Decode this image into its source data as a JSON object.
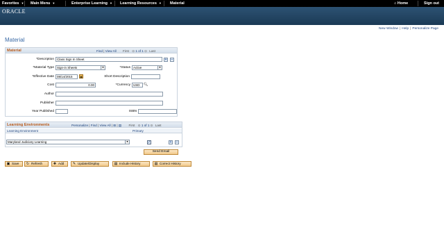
{
  "topnav": {
    "favorites": "Favorites",
    "main_menu": "Main Menu",
    "enterprise_learning": "Enterprise Learning",
    "learning_resources": "Learning Resources",
    "material": "Material",
    "home": "Home",
    "sign_out": "Sign out"
  },
  "brand": {
    "logo": "ORACLE"
  },
  "header_links": {
    "new_window": "New Window",
    "help": "Help",
    "personalize_page": "Personalize Page"
  },
  "page_title": "Material",
  "material_box": {
    "title": "Material",
    "find": "Find",
    "view_all": "View All",
    "first": "First",
    "counter": "1 of 1",
    "last": "Last",
    "description_label": "*Description",
    "description_value": "Class Sign In Sheet",
    "material_type_label": "*Material Type",
    "material_type_value": "Sign-in Sheets",
    "status_label": "*Status",
    "status_value": "Active",
    "effective_date_label": "*Effective Date",
    "effective_date_value": "08/14/2015",
    "short_description_label": "Short Description",
    "short_description_value": "",
    "cost_label": "Cost",
    "cost_value": "0.00",
    "currency_label": "*Currency",
    "currency_value": "USD",
    "author_label": "Author",
    "author_value": "",
    "publisher_label": "Publisher",
    "publisher_value": "",
    "year_published_label": "Year Published",
    "year_published_value": "",
    "isbn_label": "ISBN",
    "isbn_value": ""
  },
  "learning_env_box": {
    "title": "Learning Environments",
    "personalize": "Personalize",
    "find": "Find",
    "view_all": "View All",
    "first": "First",
    "counter": "1 of 1",
    "last": "Last",
    "col_env": "Learning Environment",
    "col_primary": "Primary",
    "env_value": "Maryland Judiciary Learning",
    "primary_checked": "✓"
  },
  "send_email": "Send Email",
  "toolbar": {
    "save": "Save",
    "refresh": "Refresh",
    "add": "Add",
    "update_display": "Update/Display",
    "include_history": "Include History",
    "correct_history": "Correct History"
  }
}
